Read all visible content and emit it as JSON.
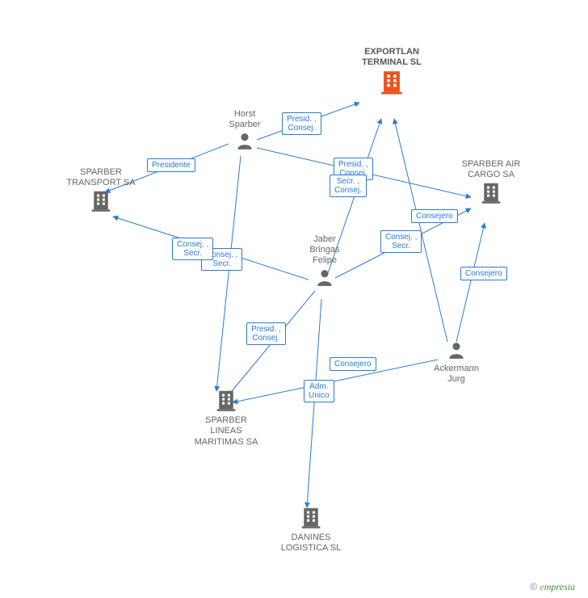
{
  "nodes": {
    "exportlan": {
      "label": "EXPORTLAN\nTERMINAL SL",
      "type": "company",
      "highlight": true
    },
    "sparber_transport": {
      "label": "SPARBER\nTRANSPORT SA",
      "type": "company"
    },
    "sparber_air_cargo": {
      "label": "SPARBER AIR\nCARGO SA",
      "type": "company"
    },
    "sparber_lineas": {
      "label": "SPARBER\nLINEAS\nMARITIMAS SA",
      "type": "company"
    },
    "danines": {
      "label": "DANINES\nLOGISTICA SL",
      "type": "company"
    },
    "horst": {
      "label": "Horst\nSparber",
      "type": "person"
    },
    "jaber": {
      "label": "Jaber\nBringas\nFelipe",
      "type": "person"
    },
    "ackermann": {
      "label": "Ackermann\nJurg",
      "type": "person"
    }
  },
  "edges": [
    {
      "from": "horst",
      "to": "exportlan",
      "role": "Presid. ,\nConsej."
    },
    {
      "from": "horst",
      "to": "sparber_transport",
      "role": "Presidente"
    },
    {
      "from": "horst",
      "to": "sparber_air_cargo",
      "role": "Presid. ,\nConsej."
    },
    {
      "from": "horst",
      "to": "sparber_lineas",
      "role": "Consej. ,\nSecr."
    },
    {
      "from": "jaber",
      "to": "exportlan",
      "role": "Secr. ,\nConsej."
    },
    {
      "from": "jaber",
      "to": "sparber_air_cargo",
      "role": "Consej. ,\nSecr."
    },
    {
      "from": "jaber",
      "to": "sparber_transport",
      "role": "Consej. ,\nSecr."
    },
    {
      "from": "jaber",
      "to": "sparber_lineas",
      "role": "Presid. ,\nConsej."
    },
    {
      "from": "jaber",
      "to": "danines",
      "role": "Adm.\nUnico"
    },
    {
      "from": "ackermann",
      "to": "exportlan",
      "role": "Consejero"
    },
    {
      "from": "ackermann",
      "to": "sparber_air_cargo",
      "role": "Consejero"
    },
    {
      "from": "ackermann",
      "to": "sparber_lineas",
      "role": "Consejero"
    }
  ],
  "footer": {
    "copy": "© ",
    "brand_e": "e",
    "brand_rest": "mpresia"
  },
  "colors": {
    "highlight": "#e9541f",
    "edge": "#2a7bd6",
    "node": "#666"
  }
}
